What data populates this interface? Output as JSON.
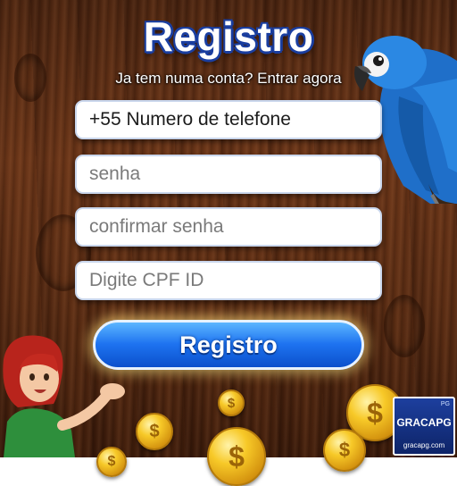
{
  "header": {
    "title": "Registro",
    "subtitle": "Ja tem numa conta? Entrar agora"
  },
  "form": {
    "phone": {
      "value": "+55 Numero de telefone",
      "placeholder": "+55 Numero de telefone"
    },
    "password": {
      "placeholder": "senha"
    },
    "confirm_password": {
      "placeholder": "confirmar senha"
    },
    "cpf": {
      "placeholder": "Digite CPF ID"
    },
    "submit_label": "Registro"
  },
  "badge": {
    "tag": "PG",
    "brand": "GRACAPG",
    "url": "gracapg.com"
  },
  "coin_symbol": "$",
  "colors": {
    "accent": "#1e73f0",
    "title_outline": "#1b3fa0",
    "wood": "#5a2c13",
    "coin": "#f7c928"
  }
}
